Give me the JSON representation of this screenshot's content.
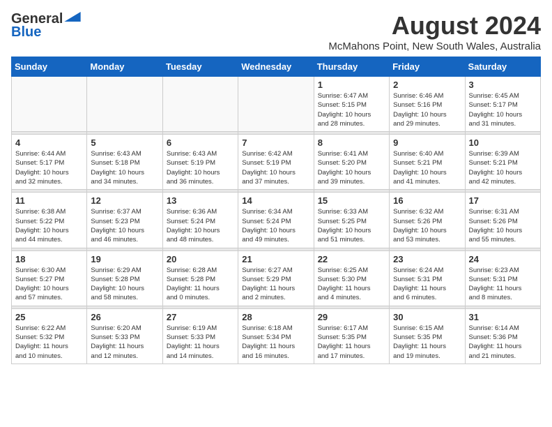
{
  "logo": {
    "line1": "General",
    "line2": "Blue"
  },
  "title": "August 2024",
  "subtitle": "McMahons Point, New South Wales, Australia",
  "headers": [
    "Sunday",
    "Monday",
    "Tuesday",
    "Wednesday",
    "Thursday",
    "Friday",
    "Saturday"
  ],
  "weeks": [
    [
      {
        "day": "",
        "info": ""
      },
      {
        "day": "",
        "info": ""
      },
      {
        "day": "",
        "info": ""
      },
      {
        "day": "",
        "info": ""
      },
      {
        "day": "1",
        "info": "Sunrise: 6:47 AM\nSunset: 5:15 PM\nDaylight: 10 hours\nand 28 minutes."
      },
      {
        "day": "2",
        "info": "Sunrise: 6:46 AM\nSunset: 5:16 PM\nDaylight: 10 hours\nand 29 minutes."
      },
      {
        "day": "3",
        "info": "Sunrise: 6:45 AM\nSunset: 5:17 PM\nDaylight: 10 hours\nand 31 minutes."
      }
    ],
    [
      {
        "day": "4",
        "info": "Sunrise: 6:44 AM\nSunset: 5:17 PM\nDaylight: 10 hours\nand 32 minutes."
      },
      {
        "day": "5",
        "info": "Sunrise: 6:43 AM\nSunset: 5:18 PM\nDaylight: 10 hours\nand 34 minutes."
      },
      {
        "day": "6",
        "info": "Sunrise: 6:43 AM\nSunset: 5:19 PM\nDaylight: 10 hours\nand 36 minutes."
      },
      {
        "day": "7",
        "info": "Sunrise: 6:42 AM\nSunset: 5:19 PM\nDaylight: 10 hours\nand 37 minutes."
      },
      {
        "day": "8",
        "info": "Sunrise: 6:41 AM\nSunset: 5:20 PM\nDaylight: 10 hours\nand 39 minutes."
      },
      {
        "day": "9",
        "info": "Sunrise: 6:40 AM\nSunset: 5:21 PM\nDaylight: 10 hours\nand 41 minutes."
      },
      {
        "day": "10",
        "info": "Sunrise: 6:39 AM\nSunset: 5:21 PM\nDaylight: 10 hours\nand 42 minutes."
      }
    ],
    [
      {
        "day": "11",
        "info": "Sunrise: 6:38 AM\nSunset: 5:22 PM\nDaylight: 10 hours\nand 44 minutes."
      },
      {
        "day": "12",
        "info": "Sunrise: 6:37 AM\nSunset: 5:23 PM\nDaylight: 10 hours\nand 46 minutes."
      },
      {
        "day": "13",
        "info": "Sunrise: 6:36 AM\nSunset: 5:24 PM\nDaylight: 10 hours\nand 48 minutes."
      },
      {
        "day": "14",
        "info": "Sunrise: 6:34 AM\nSunset: 5:24 PM\nDaylight: 10 hours\nand 49 minutes."
      },
      {
        "day": "15",
        "info": "Sunrise: 6:33 AM\nSunset: 5:25 PM\nDaylight: 10 hours\nand 51 minutes."
      },
      {
        "day": "16",
        "info": "Sunrise: 6:32 AM\nSunset: 5:26 PM\nDaylight: 10 hours\nand 53 minutes."
      },
      {
        "day": "17",
        "info": "Sunrise: 6:31 AM\nSunset: 5:26 PM\nDaylight: 10 hours\nand 55 minutes."
      }
    ],
    [
      {
        "day": "18",
        "info": "Sunrise: 6:30 AM\nSunset: 5:27 PM\nDaylight: 10 hours\nand 57 minutes."
      },
      {
        "day": "19",
        "info": "Sunrise: 6:29 AM\nSunset: 5:28 PM\nDaylight: 10 hours\nand 58 minutes."
      },
      {
        "day": "20",
        "info": "Sunrise: 6:28 AM\nSunset: 5:28 PM\nDaylight: 11 hours\nand 0 minutes."
      },
      {
        "day": "21",
        "info": "Sunrise: 6:27 AM\nSunset: 5:29 PM\nDaylight: 11 hours\nand 2 minutes."
      },
      {
        "day": "22",
        "info": "Sunrise: 6:25 AM\nSunset: 5:30 PM\nDaylight: 11 hours\nand 4 minutes."
      },
      {
        "day": "23",
        "info": "Sunrise: 6:24 AM\nSunset: 5:31 PM\nDaylight: 11 hours\nand 6 minutes."
      },
      {
        "day": "24",
        "info": "Sunrise: 6:23 AM\nSunset: 5:31 PM\nDaylight: 11 hours\nand 8 minutes."
      }
    ],
    [
      {
        "day": "25",
        "info": "Sunrise: 6:22 AM\nSunset: 5:32 PM\nDaylight: 11 hours\nand 10 minutes."
      },
      {
        "day": "26",
        "info": "Sunrise: 6:20 AM\nSunset: 5:33 PM\nDaylight: 11 hours\nand 12 minutes."
      },
      {
        "day": "27",
        "info": "Sunrise: 6:19 AM\nSunset: 5:33 PM\nDaylight: 11 hours\nand 14 minutes."
      },
      {
        "day": "28",
        "info": "Sunrise: 6:18 AM\nSunset: 5:34 PM\nDaylight: 11 hours\nand 16 minutes."
      },
      {
        "day": "29",
        "info": "Sunrise: 6:17 AM\nSunset: 5:35 PM\nDaylight: 11 hours\nand 17 minutes."
      },
      {
        "day": "30",
        "info": "Sunrise: 6:15 AM\nSunset: 5:35 PM\nDaylight: 11 hours\nand 19 minutes."
      },
      {
        "day": "31",
        "info": "Sunrise: 6:14 AM\nSunset: 5:36 PM\nDaylight: 11 hours\nand 21 minutes."
      }
    ]
  ]
}
